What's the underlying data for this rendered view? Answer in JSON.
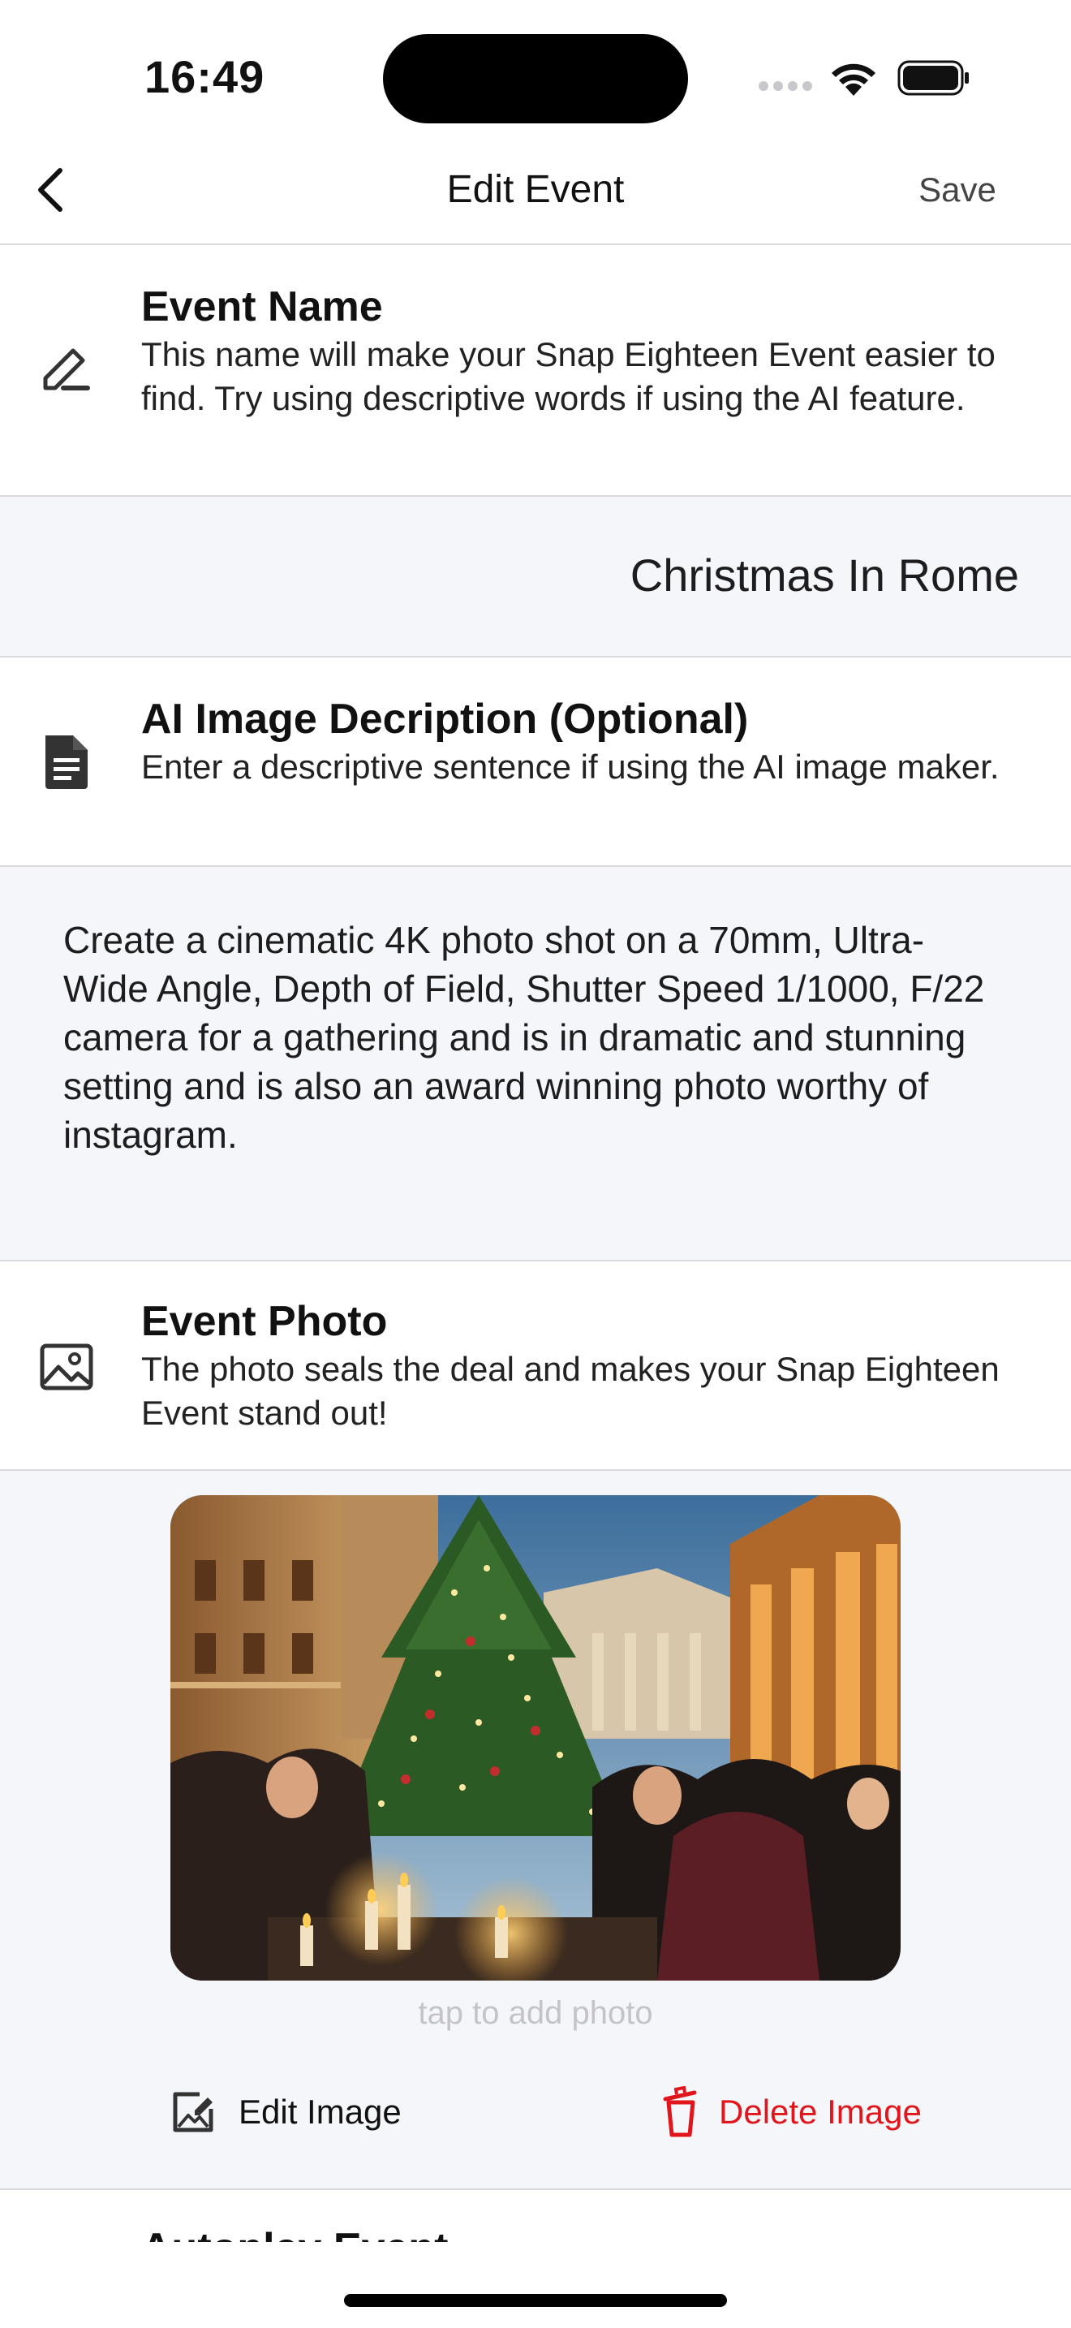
{
  "status_bar": {
    "time": "16:49"
  },
  "nav": {
    "title": "Edit Event",
    "save_label": "Save"
  },
  "event_name": {
    "title": "Event Name",
    "description": "This name will make your Snap Eighteen Event easier to find. Try using descriptive words if using the AI feature.",
    "value": "Christmas In Rome",
    "icon": "pencil-icon"
  },
  "ai_description": {
    "title": "AI Image Decription (Optional)",
    "description": "Enter a descriptive sentence if using the AI image maker.",
    "value": "Create a cinematic 4K photo shot on a 70mm, Ultra-Wide Angle, Depth of Field, Shutter Speed 1/1000, F/22 camera for a gathering and is in dramatic and stunning setting and is also an award winning photo worthy of instagram.",
    "icon": "document-icon"
  },
  "event_photo": {
    "title": "Event Photo",
    "description": "The photo seals the deal and makes your Snap Eighteen Event stand out!",
    "tap_hint": "tap to add photo",
    "edit_label": "Edit Image",
    "delete_label": "Delete Image",
    "icon": "image-icon"
  },
  "next_section": {
    "title": "Autoplay Event"
  },
  "colors": {
    "delete": "#e0161c",
    "band": "#f5f6f9",
    "divider": "#d9d9de"
  }
}
